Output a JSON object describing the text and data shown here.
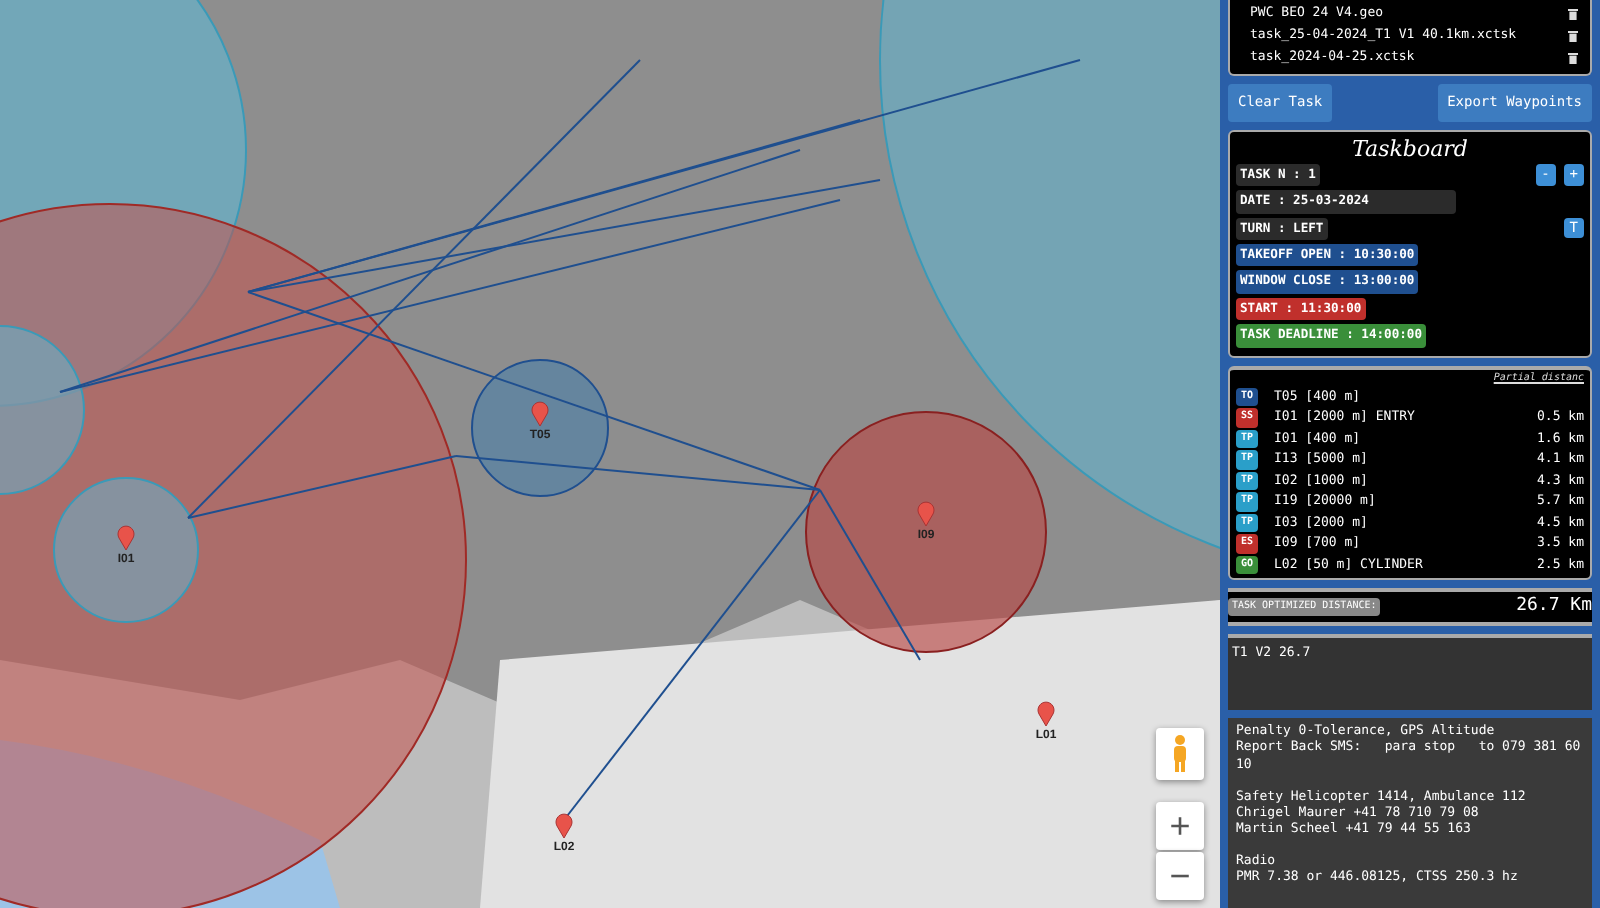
{
  "map": {
    "waypoints": [
      {
        "label": "T05"
      },
      {
        "label": "I01"
      },
      {
        "label": "I09"
      },
      {
        "label": "L02"
      },
      {
        "label": "L01"
      }
    ],
    "zoom_in": "+",
    "zoom_out": "−"
  },
  "files": [
    {
      "name": "PWC BEO 24 V4.geo"
    },
    {
      "name": "task_25-04-2024_T1 V1 40.1km.xctsk"
    },
    {
      "name": "task_2024-04-25.xctsk"
    }
  ],
  "buttons": [
    "Clear Task",
    "Export Waypoints"
  ],
  "taskboard": {
    "title": "Taskboard",
    "fields": [
      {
        "text": "TASK N : 1",
        "kind": "plain"
      },
      {
        "text": "DATE : 25-03-2024",
        "kind": "wide"
      },
      {
        "text": "TURN : LEFT",
        "kind": "plain"
      },
      {
        "text": "TAKEOFF OPEN : 10:30:00",
        "kind": "info"
      },
      {
        "text": "WINDOW CLOSE : 13:00:00",
        "kind": "info"
      },
      {
        "text": "START : 11:30:00",
        "kind": "start"
      },
      {
        "text": "TASK DEADLINE : 14:00:00",
        "kind": "deadline"
      }
    ],
    "minus": "-",
    "plus": "+",
    "turn_button": "T"
  },
  "turnpoints": {
    "header": "Partial distanc",
    "rows": [
      {
        "type": "TO",
        "color": "#1f4f8f",
        "name": "T05 [400 m]"
      },
      {
        "type": "SS",
        "color": "#c0302c",
        "name": "I01 [2000 m] ENTRY",
        "distance": "0.5 km"
      },
      {
        "type": "TP",
        "color": "#2a9fc9",
        "name": "I01 [400 m]",
        "distance": "1.6 km"
      },
      {
        "type": "TP",
        "color": "#2a9fc9",
        "name": "I13 [5000 m]",
        "distance": "4.1 km"
      },
      {
        "type": "TP",
        "color": "#2a9fc9",
        "name": "I02 [1000 m]",
        "distance": "4.3 km"
      },
      {
        "type": "TP",
        "color": "#2a9fc9",
        "name": "I19 [20000 m]",
        "distance": "5.7 km"
      },
      {
        "type": "TP",
        "color": "#2a9fc9",
        "name": "I03 [2000 m]",
        "distance": "4.5 km"
      },
      {
        "type": "ES",
        "color": "#c0302c",
        "name": "I09 [700 m]",
        "distance": "3.5 km"
      },
      {
        "type": "GO",
        "color": "#3a8f3a",
        "name": "L02 [50 m] CYLINDER",
        "distance": "2.5 km"
      }
    ]
  },
  "optimized": {
    "label": "TASK OPTIMIZED DISTANCE:",
    "value": "26.7 Km"
  },
  "notes_1": "T1 V2 26.7",
  "notes_2": [
    [
      "Penalty 0-Tolerance, GPS Altitude",
      "Report Back SMS:   para stop   to 079 381 60 10"
    ],
    [
      "Safety Helicopter 1414, Ambulance 112",
      "Chrigel Maurer +41 78 710 79 08",
      "Martin Scheel +41 79 44 55 163"
    ],
    [
      "Radio",
      "PMR 7.38 or 446.08125, CTSS 250.3 hz"
    ]
  ]
}
